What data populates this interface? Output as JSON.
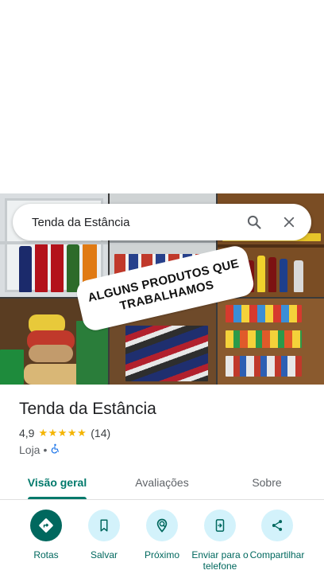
{
  "search": {
    "value": "Tenda da Estância",
    "search_icon": "search-icon",
    "close_icon": "close-icon"
  },
  "photo": {
    "overlay_line1": "ALGUNS PRODUTOS QUE",
    "overlay_line2": "TRABALHAMOS"
  },
  "place": {
    "title": "Tenda da Estância",
    "rating": "4,9",
    "stars": "★★★★★",
    "review_count": "(14)",
    "category": "Loja",
    "separator": "•",
    "accessibility_icon": "wheelchair-icon"
  },
  "tabs": [
    {
      "label": "Visão geral",
      "active": true
    },
    {
      "label": "Avaliações",
      "active": false
    },
    {
      "label": "Sobre",
      "active": false
    }
  ],
  "actions": [
    {
      "label": "Rotas",
      "icon": "directions-icon"
    },
    {
      "label": "Salvar",
      "icon": "bookmark-icon"
    },
    {
      "label": "Próximo",
      "icon": "nearby-icon"
    },
    {
      "label": "Enviar para o telefone",
      "icon": "send-to-phone-icon"
    },
    {
      "label": "Compartilhar",
      "icon": "share-icon"
    }
  ],
  "colors": {
    "accent": "#00796b",
    "action_bg": "#d3f2fb",
    "primary_action": "#00685e",
    "star": "#f4b400"
  }
}
